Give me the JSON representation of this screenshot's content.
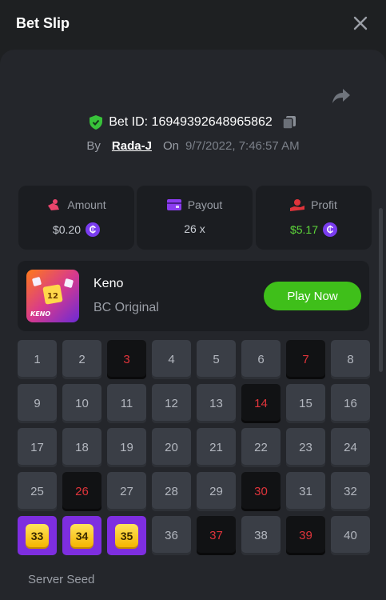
{
  "header": {
    "title": "Bet Slip"
  },
  "bet": {
    "id_text": "Bet ID: 16949392648965862",
    "by_label": "By",
    "username": "Rada-J",
    "on_label": "On",
    "datetime": "9/7/2022, 7:46:57 AM"
  },
  "stats": {
    "amount": {
      "label": "Amount",
      "value": "$0.20"
    },
    "payout": {
      "label": "Payout",
      "value": "26 x"
    },
    "profit": {
      "label": "Profit",
      "value": "$5.17"
    }
  },
  "game": {
    "name": "Keno",
    "subtitle": "BC Original",
    "play_label": "Play Now",
    "thumb_number": "12",
    "thumb_text": "KENO"
  },
  "keno": {
    "numbers": [
      "1",
      "2",
      "3",
      "4",
      "5",
      "6",
      "7",
      "8",
      "9",
      "10",
      "11",
      "12",
      "13",
      "14",
      "15",
      "16",
      "17",
      "18",
      "19",
      "20",
      "21",
      "22",
      "23",
      "24",
      "25",
      "26",
      "27",
      "28",
      "29",
      "30",
      "31",
      "32",
      "33",
      "34",
      "35",
      "36",
      "37",
      "38",
      "39",
      "40"
    ],
    "missed": [
      3,
      7,
      14,
      26,
      30,
      37,
      39
    ],
    "hits": [
      33,
      34,
      35
    ]
  },
  "seed": {
    "label": "Server Seed"
  },
  "colors": {
    "accent_green": "#3fbf1a",
    "coin_purple": "#7a3cf0",
    "miss_red": "#e0343b",
    "hit_purple": "#7e2ee0",
    "gem_yellow": "#f5c400"
  },
  "icons": [
    "close-icon",
    "share-icon",
    "shield-check-icon",
    "copy-icon",
    "amount-icon",
    "payout-icon",
    "profit-icon",
    "coin-icon"
  ]
}
